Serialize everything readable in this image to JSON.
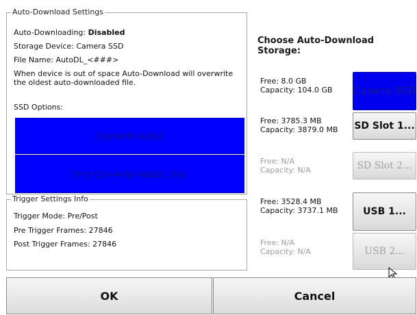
{
  "auto_download": {
    "title": "Auto-Download Settings",
    "auto_downloading_label": "Auto-Downloading:",
    "auto_downloading_value": "Disabled",
    "storage_device": "Storage Device: Camera SSD",
    "file_name": "File Name: AutoDL_<###>",
    "warning_line1": "When device is out of space Auto-Download will overwrite",
    "warning_line2": "the oldest auto-downloaded file.",
    "ssd_options_label": "SSD Options:",
    "overwrite_oldest_label": "Overwrite oldest",
    "only_overwrite_label": "Only Overwrite AutoDL files"
  },
  "trigger": {
    "title": "Trigger Settings Info",
    "mode": "Trigger Mode: Pre/Post",
    "pre_frames": "Pre Trigger Frames: 27846",
    "post_frames": "Post Trigger Frames: 27846"
  },
  "storage": {
    "title": "Choose Auto-Download Storage:",
    "devices": [
      {
        "free": "Free: 8.0 GB",
        "capacity": "Capacity: 104.0 GB",
        "button": "Camera SSD",
        "state": "selected"
      },
      {
        "free": "Free: 3785.3 MB",
        "capacity": "Capacity: 3879.0 MB",
        "button": "SD Slot 1...",
        "state": "enabled"
      },
      {
        "free": "Free: N/A",
        "capacity": "Capacity: N/A",
        "button": "SD Slot 2...",
        "state": "disabled"
      },
      {
        "free": "Free: 3528.4 MB",
        "capacity": "Capacity: 3737.1 MB",
        "button": "USB 1...",
        "state": "enabled"
      },
      {
        "free": "Free: N/A",
        "capacity": "Capacity: N/A",
        "button": "USB 2...",
        "state": "disabled"
      }
    ]
  },
  "footer": {
    "ok_label": "OK",
    "cancel_label": "Cancel"
  },
  "colors": {
    "accent_blue": "#0000ff",
    "disabled_text": "#9c9c9c"
  }
}
